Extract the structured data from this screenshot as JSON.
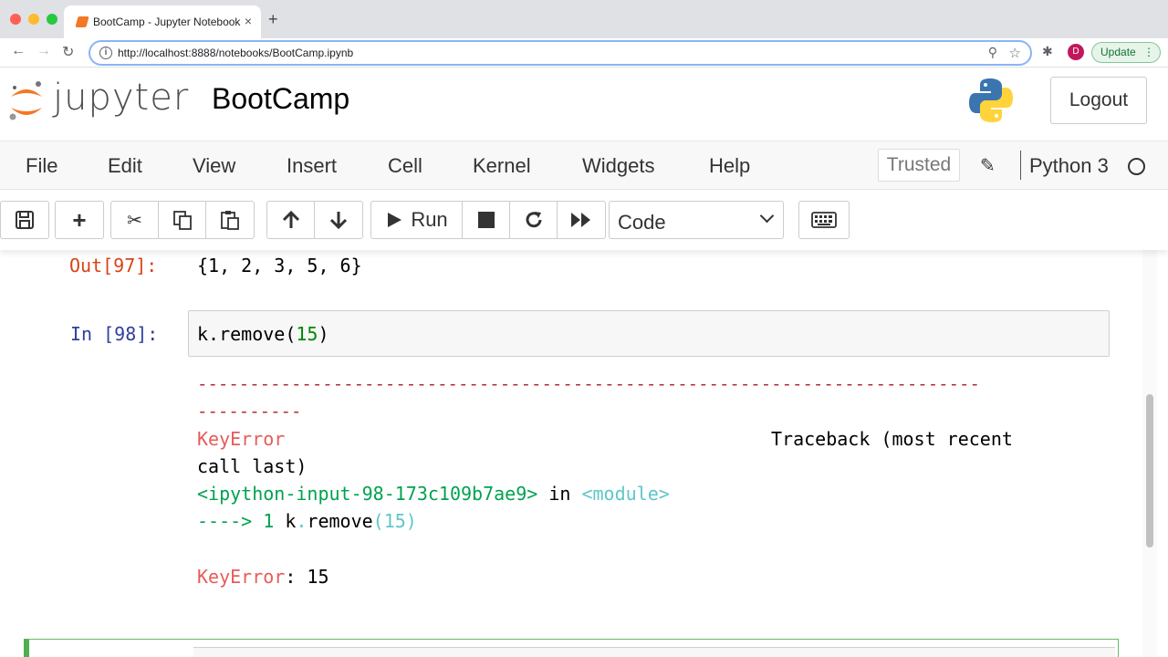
{
  "browser": {
    "tab_title": "BootCamp - Jupyter Notebook",
    "tab_close": "×",
    "new_tab": "+",
    "url": "http://localhost:8888/notebooks/BootCamp.ipynb",
    "avatar_letter": "D",
    "update_label": "Update"
  },
  "header": {
    "logo_text": "jupyter",
    "notebook_title": "BootCamp",
    "logout_label": "Logout"
  },
  "menu": {
    "items": [
      "File",
      "Edit",
      "View",
      "Insert",
      "Cell",
      "Kernel",
      "Widgets",
      "Help"
    ],
    "trusted_label": "Trusted",
    "kernel_name": "Python 3"
  },
  "toolbar": {
    "run_label": "Run",
    "cell_type": "Code"
  },
  "cells": {
    "out_prompt": "Out[97]:",
    "out_value": "{1, 2, 3, 5, 6}",
    "in_prompt": "In [98]:",
    "code_prefix": "k.remove(",
    "code_arg": "15",
    "code_suffix": ")",
    "tb_dashes1": "---------------------------------------------------------------------------",
    "tb_dashes2": "----------",
    "tb_error": "KeyError",
    "tb_header": "Traceback (most recent",
    "tb_header2": "call last)",
    "tb_file": "<ipython-input-98-173c109b7ae9>",
    "tb_in": " in ",
    "tb_module": "<module>",
    "tb_arrow": "----> 1 ",
    "tb_line_a": "k",
    "tb_line_dot": ".",
    "tb_line_b": "remove",
    "tb_line_c": "(15)",
    "final_error": "KeyError",
    "final_msg": ": 15"
  }
}
